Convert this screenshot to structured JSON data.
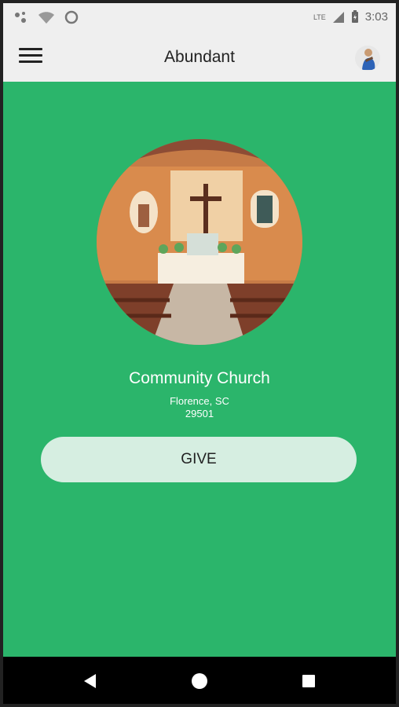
{
  "status_bar": {
    "network": "LTE",
    "time": "3:03"
  },
  "app_bar": {
    "title": "Abundant"
  },
  "church": {
    "name": "Community Church",
    "city_state": "Florence, SC",
    "zip": "29501"
  },
  "actions": {
    "give_label": "GIVE"
  },
  "colors": {
    "accent": "#2bb56b",
    "button": "#d6eee1"
  },
  "icons": {
    "menu": "hamburger-menu-icon",
    "profile": "avatar-icon",
    "sheet_handle": "chevron-up-icon",
    "back": "back-triangle-icon",
    "home": "home-circle-icon",
    "recents": "recents-square-icon"
  }
}
